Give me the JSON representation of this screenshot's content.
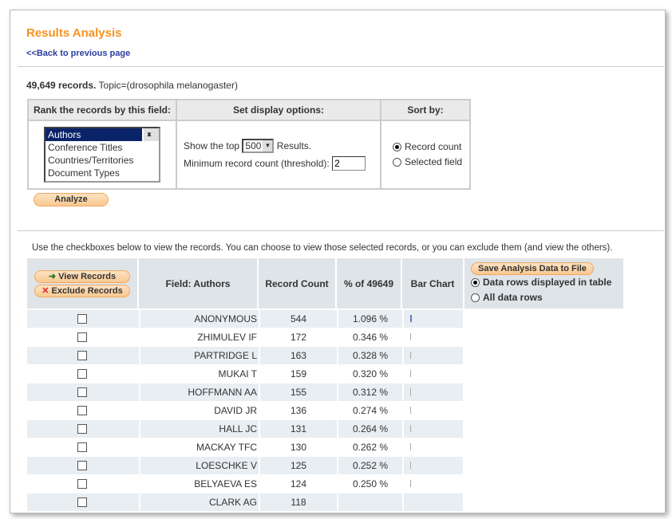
{
  "title": "Results Analysis",
  "back_link": "<<Back to previous page",
  "summary": {
    "count": "49,649 records.",
    "topic": "Topic=(drosophila melanogaster)"
  },
  "options": {
    "rank_header": "Rank the records by this field:",
    "display_header": "Set display options:",
    "sort_header": "Sort by:",
    "fields": [
      "Authors",
      "Conference Titles",
      "Countries/Territories",
      "Document Types"
    ],
    "selected_field": "Authors",
    "show_top_label": "Show the top",
    "show_top_value": "500",
    "results_label": "Results.",
    "threshold_label": "Minimum record count (threshold):",
    "threshold_value": "2",
    "sort_options": [
      "Record count",
      "Selected field"
    ],
    "sort_selected": "Record count",
    "analyze": "Analyze"
  },
  "instructions": "Use the checkboxes below to view the records. You can choose to view those selected records, or you can exclude them (and view the others).",
  "results": {
    "view_records": "View Records",
    "exclude_records": "Exclude Records",
    "headers": [
      "Field: Authors",
      "Record Count",
      "% of 49649",
      "Bar Chart"
    ],
    "save_button": "Save Analysis Data to File",
    "save_options": [
      "Data rows displayed in table",
      "All data rows"
    ],
    "save_selected": "Data rows displayed in table",
    "rows": [
      {
        "name": "ANONYMOUS",
        "count": "544",
        "pct": "1.096 %"
      },
      {
        "name": "ZHIMULEV IF",
        "count": "172",
        "pct": "0.346 %"
      },
      {
        "name": "PARTRIDGE L",
        "count": "163",
        "pct": "0.328 %"
      },
      {
        "name": "MUKAI T",
        "count": "159",
        "pct": "0.320 %"
      },
      {
        "name": "HOFFMANN AA",
        "count": "155",
        "pct": "0.312 %"
      },
      {
        "name": "DAVID JR",
        "count": "136",
        "pct": "0.274 %"
      },
      {
        "name": "HALL JC",
        "count": "131",
        "pct": "0.264 %"
      },
      {
        "name": "MACKAY TFC",
        "count": "130",
        "pct": "0.262 %"
      },
      {
        "name": "LOESCHKE V",
        "count": "125",
        "pct": "0.252 %"
      },
      {
        "name": "BELYAEVA ES",
        "count": "124",
        "pct": "0.250 %"
      },
      {
        "name": "CLARK AG",
        "count": "118",
        "pct": ""
      }
    ]
  }
}
